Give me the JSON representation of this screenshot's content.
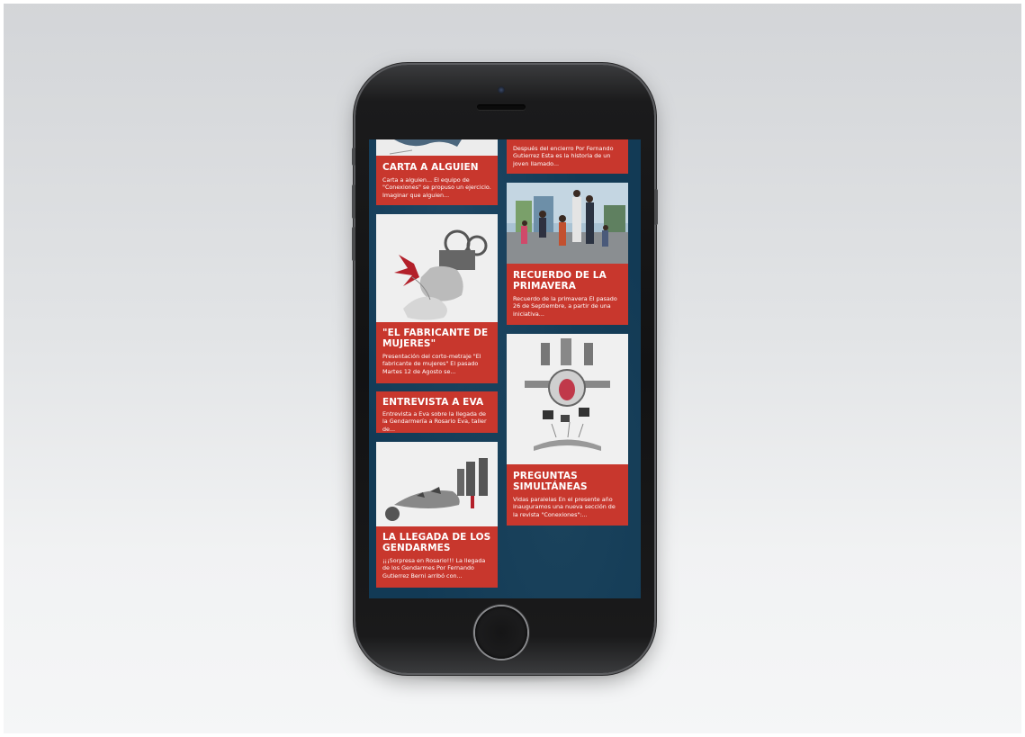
{
  "posts": [
    {
      "title": "CARTA A ALGUIEN",
      "excerpt": "Carta a alguien... El equipo de \"Conexiones\" se propuso un ejercicio. Imaginar que alguien..."
    },
    {
      "title": "\"EL FABRICANTE DE MUJERES\"",
      "excerpt": "Presentación del corto-metraje \"El fabricante de mujeres\" El pasado Martes 12 de Agosto se..."
    },
    {
      "title": "ENTREVISTA A EVA",
      "excerpt": "Entrevista a Eva sobre la llegada de la Gendarmería a Rosario Eva, taller de..."
    },
    {
      "title": "LA LLEGADA DE LOS GENDARMES",
      "excerpt": "¡¡¡Sorpresa en Rosario!!! La llegada de los Gendarmes Por Fernando Gutierrez Berni arribó con..."
    },
    {
      "title": "",
      "excerpt": "Después del encierro Por Fernando Gutierrez Esta es la historia de un joven llamado..."
    },
    {
      "title": "RECUERDO DE LA PRIMAVERA",
      "excerpt": "Recuerdo de la primavera El pasado 26 de Septiembre, a partir de una iniciativa..."
    },
    {
      "title": "PREGUNTAS SIMULTÁNEAS",
      "excerpt": "Vidas paralelas En el presente año inauguramos una nueva sección de la revista \"Conexiones\":..."
    }
  ],
  "colors": {
    "card": "#c8372d",
    "background": "#123a55",
    "phone": "#121213"
  }
}
